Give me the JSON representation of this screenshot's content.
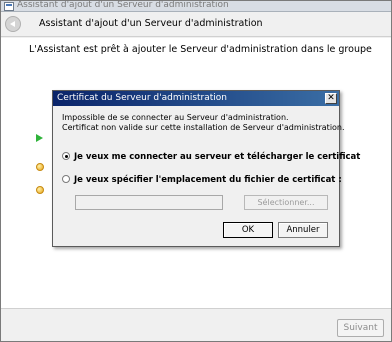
{
  "window": {
    "title": "Assistant d'ajout d'un Serveur d'administration",
    "icon": "app-window-icon"
  },
  "header": {
    "title": "Assistant d'ajout d'un Serveur d'administration",
    "back_icon": "back-arrow-icon"
  },
  "main": {
    "intro": "L'Assistant est prêt à ajouter le Serveur d'administration dans le groupe",
    "steps": [
      {
        "icon": "current-step-arrow-icon",
        "color": "#2fb33a"
      },
      {
        "icon": "pending-step-dot-icon",
        "color": "#e8a417"
      },
      {
        "icon": "pending-step-dot-icon",
        "color": "#e8a417"
      }
    ]
  },
  "footer": {
    "next_label": "Suivant"
  },
  "dialog": {
    "title": "Certificat du Serveur d'administration",
    "close_glyph": "✕",
    "message_line1": "Impossible de se connecter au Serveur d'administration.",
    "message_line2": "Certificat non valide sur cette installation de Serveur d'administration.",
    "option_download": "Je veux me connecter au serveur et télécharger le certificat",
    "option_specify": "Je veux spécifier l'emplacement du fichier de certificat :",
    "selected_option": "download",
    "path_value": "",
    "browse_label": "Sélectionner...",
    "ok_label": "OK",
    "cancel_label": "Annuler"
  },
  "colors": {
    "dialog_title_start": "#0a246a",
    "dialog_title_end": "#3a6ea5"
  }
}
